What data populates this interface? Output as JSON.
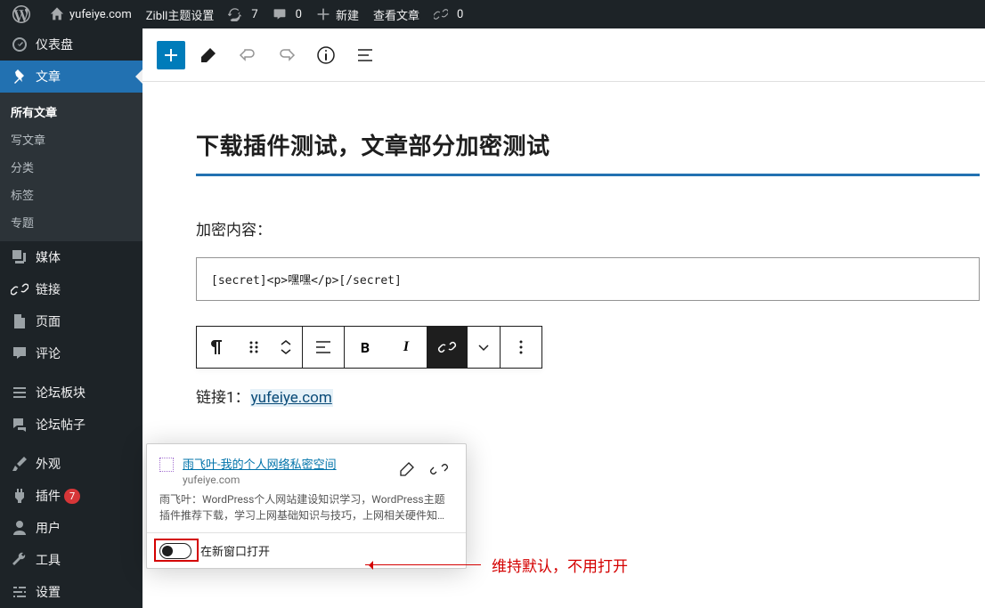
{
  "adminbar": {
    "site_name": "yufeiye.com",
    "theme_settings": "Zibll主题设置",
    "updates_count": "7",
    "comments_count": "0",
    "new_label": "新建",
    "view_posts": "查看文章",
    "links_count": "0"
  },
  "sidebar": {
    "dashboard": "仪表盘",
    "posts": "文章",
    "posts_sub": {
      "all": "所有文章",
      "new": "写文章",
      "categories": "分类",
      "tags": "标签",
      "topics": "专题"
    },
    "media": "媒体",
    "links": "链接",
    "pages": "页面",
    "comments": "评论",
    "forum_sections": "论坛板块",
    "forum_posts": "论坛帖子",
    "appearance": "外观",
    "plugins": "插件",
    "plugins_updates": "7",
    "users": "用户",
    "tools": "工具",
    "settings": "设置"
  },
  "editor": {
    "title": "下载插件测试，文章部分加密测试",
    "section_encrypted": "加密内容：",
    "code_content": "[secret]<p>嘿嘿</p>[/secret]",
    "link_label": "链接1：",
    "link_text": "yufeiye.com"
  },
  "block_toolbar": {
    "bold": "B",
    "italic": "I"
  },
  "link_popover": {
    "title": "雨飞叶-我的个人网络私密空间",
    "url": "yufeiye.com",
    "description": "雨飞叶：WordPress个人网站建设知识学习，WordPress主题插件推荐下载，学习上网基础知识与技巧，上网相关硬件知…",
    "toggle_label": "在新窗口打开"
  },
  "annotation": {
    "text": "维持默认，不用打开"
  }
}
